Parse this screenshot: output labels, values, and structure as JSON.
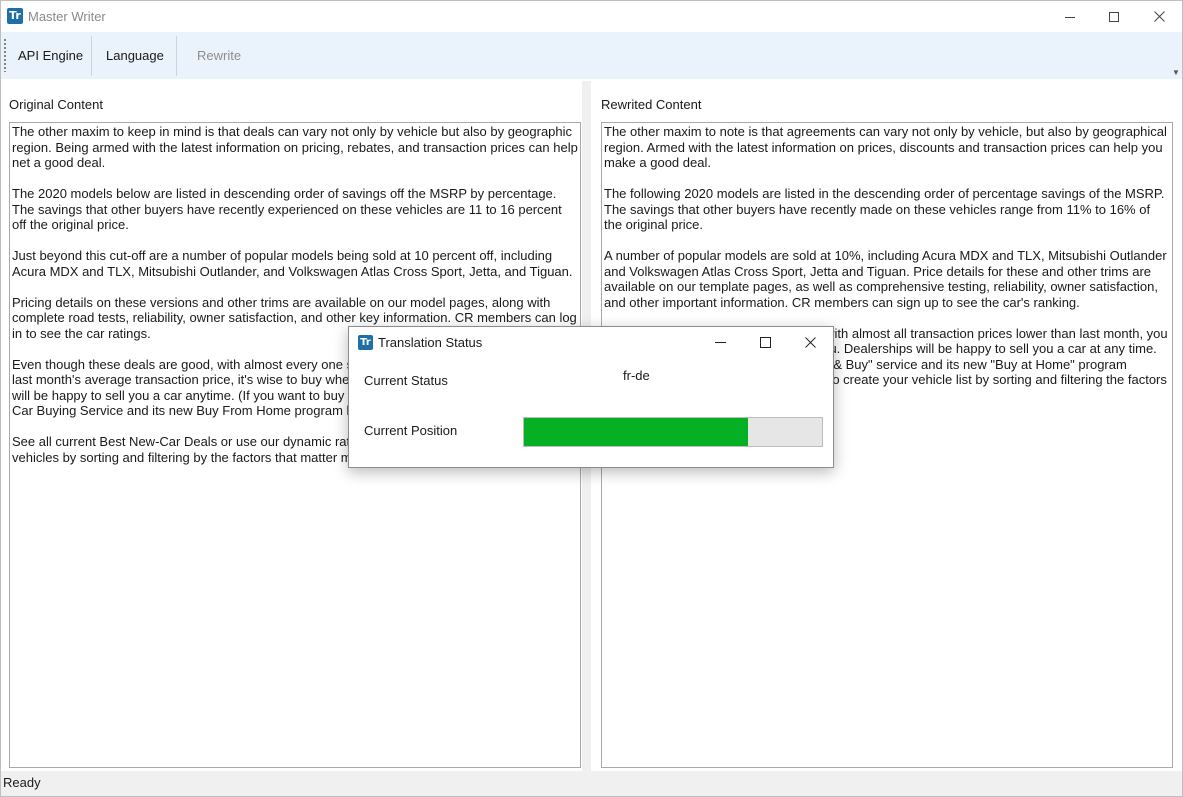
{
  "window": {
    "title": "Master Writer",
    "logo_text": "Tr",
    "controls": [
      "minimize",
      "maximize",
      "close"
    ]
  },
  "toolbar": {
    "items": [
      {
        "label": "API Engine",
        "enabled": true
      },
      {
        "label": "Language",
        "enabled": true
      },
      {
        "label": "Rewrite",
        "enabled": false
      }
    ]
  },
  "original": {
    "label": "Original Content",
    "paragraphs": [
      "The other maxim to keep in mind is that deals can vary not only by vehicle but also by geographic region. Being armed with the latest information on pricing, rebates, and transaction prices can help net a good deal.",
      "The 2020 models below are listed in descending order of savings off the MSRP by percentage. The savings that other buyers have recently experienced on these vehicles are 11 to 16 percent off the original price.",
      "Just beyond this cut-off are a number of popular models being sold at 10 percent off, including Acura MDX and TLX, Mitsubishi Outlander, and Volkswagen Atlas Cross Sport, Jetta, and Tiguan.",
      "Pricing details on these versions and other trims are available on our model pages, along with complete road tests, reliability, owner satisfaction, and other key information. CR members can log in to see the car ratings.",
      "Even though these deals are good, with almost every one seeing a lower transaction price than last month's average transaction price, it's wise to buy when the time is right for you. Dealerships will be happy to sell you a car anytime. (If you want to buy now, read about the CR Build & Buy Car Buying Service and its new Buy From Home program below.)",
      "See all current Best New-Car Deals or use our dynamic ratings chart to create your own list of vehicles by sorting and filtering by the factors that matter most to you."
    ]
  },
  "rewrited": {
    "label": "Rewrited Content",
    "paragraphs": [
      "The other maxim to note is that agreements can vary not only by vehicle, but also by geographical region. Armed with the latest information on prices, discounts and transaction prices can help you make a good deal.",
      "The following 2020 models are listed in the descending order of percentage savings of the MSRP. The savings that other buyers have recently made on these vehicles range from 11% to 16% of the original price.",
      "A number of popular models are sold at 10%, including Acura MDX and TLX, Mitsubishi Outlander and Volkswagen Atlas Cross Sport, Jetta and Tiguan. Price details for these and other trims are available on our template pages, as well as comprehensive testing, reliability, owner satisfaction, and other important information. CR members can sign up to see the car's ranking.",
      "Although these agreements are good, with almost all transaction prices lower than last month, you should buy when the time is right for you. Dealerships will be happy to sell you a car at any time. (If you want to buy now, read \"CR Build & Buy\" service and its new \"Buy at Home\" program below.) Use our dynamic ranking chart to create your vehicle list by sorting and filtering the factors important to you."
    ]
  },
  "status_bar": {
    "text": "Ready"
  },
  "dialog": {
    "title": "Translation Status",
    "logo_text": "Tr",
    "status_label": "Current Status",
    "status_value": "fr-de",
    "position_label": "Current Position",
    "progress_fraction": 0.75,
    "progress_color": "#06b025"
  },
  "colors": {
    "toolbar_bg": "#eaf2fc",
    "logo_bg": "#1e6fa8"
  }
}
